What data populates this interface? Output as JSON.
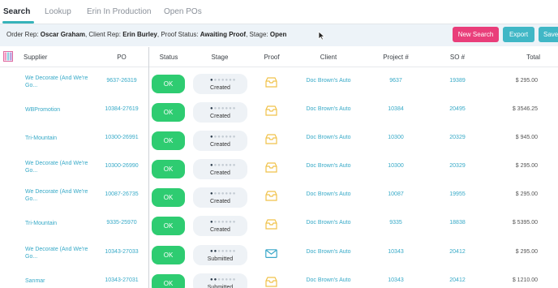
{
  "tabs": [
    "Search",
    "Lookup",
    "Erin In Production",
    "Open POs"
  ],
  "criteria": [
    {
      "label": "Order Rep: ",
      "value": "Oscar Graham"
    },
    {
      "label": ", Client Rep: ",
      "value": "Erin Burley"
    },
    {
      "label": ", Proof Status: ",
      "value": "Awaiting Proof"
    },
    {
      "label": ", Stage: ",
      "value": "Open"
    }
  ],
  "buttons": {
    "new_search": "New Search",
    "export": "Export",
    "save": "Save"
  },
  "columns": {
    "supplier": "Supplier",
    "po": "PO",
    "status": "Status",
    "stage": "Stage",
    "proof": "Proof",
    "client": "Client",
    "project": "Project #",
    "so": "SO #",
    "total": "Total"
  },
  "icons": {
    "column_picker": "columns-icon",
    "proof_awaiting": "mail-open-icon",
    "proof_submitted": "envelope-icon",
    "cursor": "mouse-cursor-icon"
  },
  "colors": {
    "accent": "#36b3ba",
    "link": "#36a9c7",
    "ok": "#2ecc71",
    "new_search": "#e93e7a",
    "proof_awaiting": "#f0c24a",
    "proof_submitted": "#3aa7c9"
  },
  "rows": [
    {
      "supplier": "We Decorate (And We're Go...",
      "po": "9637-26319",
      "status": "OK",
      "stage": "Created",
      "stage_step": 1,
      "proof": "awaiting",
      "client": "Doc Brown's Auto",
      "project": "9637",
      "so": "19389",
      "total": "$ 295.00"
    },
    {
      "supplier": "WBPromotion",
      "po": "10384-27619",
      "status": "OK",
      "stage": "Created",
      "stage_step": 1,
      "proof": "awaiting",
      "client": "Doc Brown's Auto",
      "project": "10384",
      "so": "20495",
      "total": "$ 3546.25"
    },
    {
      "supplier": "Tri-Mountain",
      "po": "10300-26991",
      "status": "OK",
      "stage": "Created",
      "stage_step": 1,
      "proof": "awaiting",
      "client": "Doc Brown's Auto",
      "project": "10300",
      "so": "20329",
      "total": "$ 945.00"
    },
    {
      "supplier": "We Decorate (And We're Go...",
      "po": "10300-26990",
      "status": "OK",
      "stage": "Created",
      "stage_step": 1,
      "proof": "awaiting",
      "client": "Doc Brown's Auto",
      "project": "10300",
      "so": "20329",
      "total": "$ 295.00"
    },
    {
      "supplier": "We Decorate (And We're Go...",
      "po": "10087-26735",
      "status": "OK",
      "stage": "Created",
      "stage_step": 1,
      "proof": "awaiting",
      "client": "Doc Brown's Auto",
      "project": "10087",
      "so": "19955",
      "total": "$ 295.00"
    },
    {
      "supplier": "Tri-Mountain",
      "po": "9335-25970",
      "status": "OK",
      "stage": "Created",
      "stage_step": 1,
      "proof": "awaiting",
      "client": "Doc Brown's Auto",
      "project": "9335",
      "so": "18838",
      "total": "$ 5395.00"
    },
    {
      "supplier": "We Decorate (And We're Go...",
      "po": "10343-27033",
      "status": "OK",
      "stage": "Submitted",
      "stage_step": 2,
      "proof": "submitted",
      "client": "Doc Brown's Auto",
      "project": "10343",
      "so": "20412",
      "total": "$ 295.00"
    },
    {
      "supplier": "Sanmar",
      "po": "10343-27031",
      "status": "OK",
      "stage": "Submitted",
      "stage_step": 2,
      "proof": "awaiting",
      "client": "Doc Brown's Auto",
      "project": "10343",
      "so": "20412",
      "total": "$ 1210.00"
    }
  ]
}
